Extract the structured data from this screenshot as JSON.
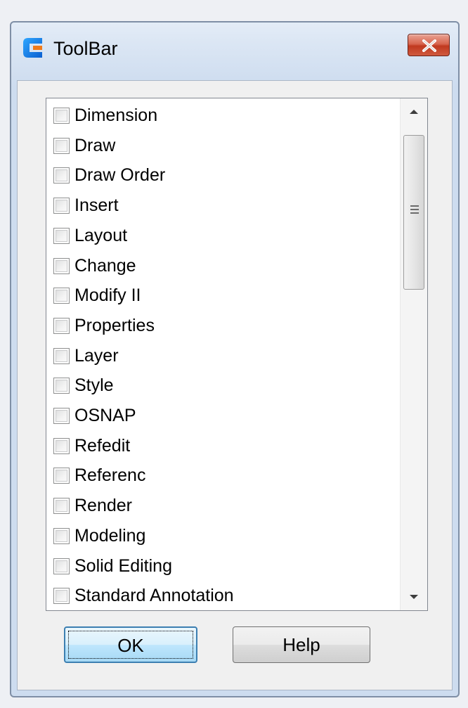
{
  "window": {
    "title": "ToolBar",
    "app_icon": "gstarcad-c-icon",
    "close_icon": "close-x-icon"
  },
  "list": {
    "items": [
      {
        "label": "Dimension",
        "checked": false
      },
      {
        "label": "Draw",
        "checked": false
      },
      {
        "label": "Draw Order",
        "checked": false
      },
      {
        "label": "Insert",
        "checked": false
      },
      {
        "label": "Layout",
        "checked": false
      },
      {
        "label": "Change",
        "checked": false
      },
      {
        "label": "Modify II",
        "checked": false
      },
      {
        "label": "Properties",
        "checked": false
      },
      {
        "label": "Layer",
        "checked": false
      },
      {
        "label": "Style",
        "checked": false
      },
      {
        "label": "OSNAP",
        "checked": false
      },
      {
        "label": "Refedit",
        "checked": false
      },
      {
        "label": "Referenc",
        "checked": false
      },
      {
        "label": "Render",
        "checked": false
      },
      {
        "label": "Modeling",
        "checked": false
      },
      {
        "label": "Solid Editing",
        "checked": false
      },
      {
        "label": "Standard Annotation",
        "checked": false
      }
    ]
  },
  "buttons": {
    "ok_label": "OK",
    "help_label": "Help"
  },
  "colors": {
    "title_gradient": "#dbe6f4",
    "close_button": "#c0391f",
    "ok_focus": "#3c7fb1",
    "list_background": "#ffffff"
  }
}
